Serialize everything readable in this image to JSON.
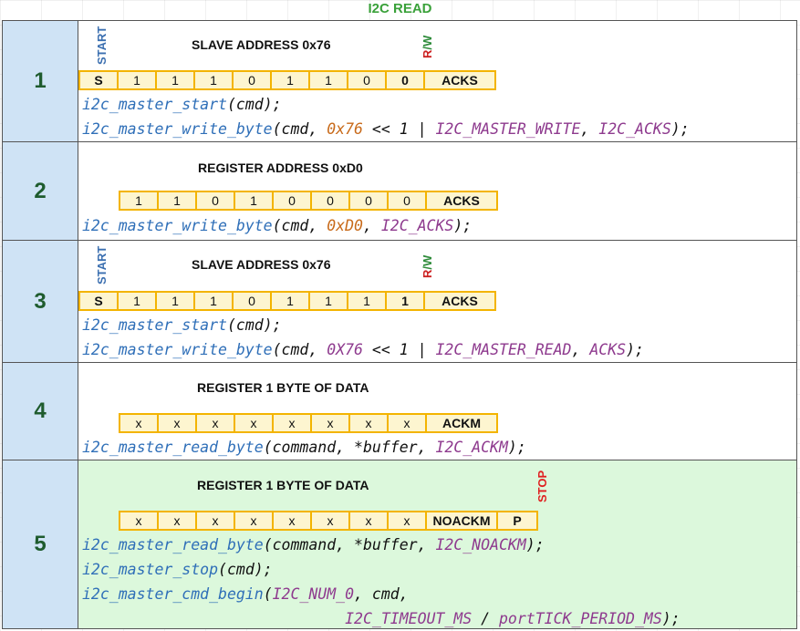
{
  "title": "I2C READ",
  "sections": [
    {
      "number": "1",
      "start_label": "START",
      "heading": "SLAVE ADDRESS 0x76",
      "rw_label_r": "R",
      "rw_label_rest": "/W",
      "bits": [
        "S",
        "1",
        "1",
        "1",
        "0",
        "1",
        "1",
        "0",
        "0",
        "ACKS"
      ],
      "code": {
        "l1_fn": "i2c_master_start",
        "l1_rest": "(cmd);",
        "l2_fn": "i2c_master_write_byte",
        "l2_p1": "(cmd, ",
        "l2_num": "0x76",
        "l2_p2": " << 1 | ",
        "l2_c1": "I2C_MASTER_WRITE",
        "l2_p3": ", ",
        "l2_c2": "I2C_ACKS",
        "l2_p4": ");"
      }
    },
    {
      "number": "2",
      "heading": "REGISTER ADDRESS 0xD0",
      "bits": [
        "1",
        "1",
        "0",
        "1",
        "0",
        "0",
        "0",
        "0",
        "ACKS"
      ],
      "code": {
        "l1_fn": "i2c_master_write_byte",
        "l1_p1": "(cmd, ",
        "l1_num": "0xD0",
        "l1_p2": ", ",
        "l1_c1": "I2C_ACKS",
        "l1_p3": ");"
      }
    },
    {
      "number": "3",
      "start_label": "START",
      "heading": "SLAVE ADDRESS 0x76",
      "rw_label_r": "R",
      "rw_label_rest": "/W",
      "bits": [
        "S",
        "1",
        "1",
        "1",
        "0",
        "1",
        "1",
        "1",
        "1",
        "ACKS"
      ],
      "code": {
        "l1_fn": "i2c_master_start",
        "l1_rest": "(cmd);",
        "l2_fn": "i2c_master_write_byte",
        "l2_p1": "(cmd, ",
        "l2_c0": "0X76",
        "l2_p2": " << 1 | ",
        "l2_c1": "I2C_MASTER_READ",
        "l2_p3": ", ",
        "l2_c2": "ACKS",
        "l2_p4": ");"
      }
    },
    {
      "number": "4",
      "heading": "REGISTER 1 BYTE OF DATA",
      "bits": [
        "x",
        "x",
        "x",
        "x",
        "x",
        "x",
        "x",
        "x",
        "ACKM"
      ],
      "code": {
        "l1_fn": "i2c_master_read_byte",
        "l1_p1": "(command, *buffer, ",
        "l1_c1": "I2C_ACKM",
        "l1_p2": ");"
      }
    },
    {
      "number": "5",
      "heading": "REGISTER 1 BYTE OF DATA",
      "stop_label": "STOP",
      "bits": [
        "x",
        "x",
        "x",
        "x",
        "x",
        "x",
        "x",
        "x",
        "NOACKM",
        "P"
      ],
      "code": {
        "l1_fn": "i2c_master_read_byte",
        "l1_p1": "(command, *buffer, ",
        "l1_c1": "I2C_NOACKM",
        "l1_p2": ");",
        "l2_fn": "i2c_master_stop",
        "l2_rest": "(cmd);",
        "l3_fn": "i2c_master_cmd_begin",
        "l3_p1": "(",
        "l3_c1": "I2C_NUM_0",
        "l3_p2": ", cmd,",
        "l4_indent": "                             ",
        "l4_c1": "I2C_TIMEOUT_MS",
        "l4_p1": " / ",
        "l4_c2": "portTICK_PERIOD_MS",
        "l4_p2": ");"
      }
    }
  ],
  "colors": {
    "title": "#3aa13a",
    "number_cell": "#cfe3f5",
    "bit_fill": "#fdf5d0",
    "bit_border": "#f3b400",
    "function": "#2f6fb8",
    "hex_number": "#c86a1a",
    "constant": "#8e3a8e",
    "highlight_section": "#dcf8dc"
  }
}
